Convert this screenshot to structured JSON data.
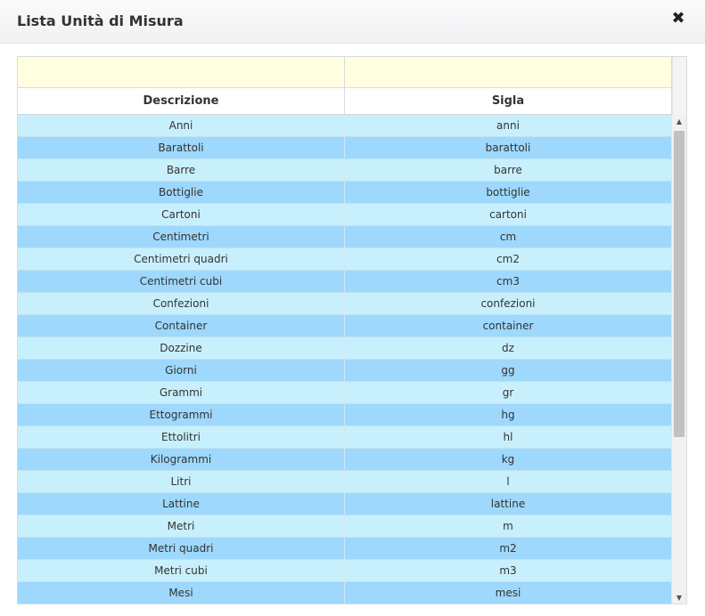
{
  "dialog": {
    "title": "Lista Unità di Misura",
    "close_glyph": "✖"
  },
  "grid": {
    "columns": [
      "Descrizione",
      "Sigla"
    ],
    "filters": [
      "",
      ""
    ],
    "rows": [
      {
        "descrizione": "Anni",
        "sigla": "anni"
      },
      {
        "descrizione": "Barattoli",
        "sigla": "barattoli"
      },
      {
        "descrizione": "Barre",
        "sigla": "barre"
      },
      {
        "descrizione": "Bottiglie",
        "sigla": "bottiglie"
      },
      {
        "descrizione": "Cartoni",
        "sigla": "cartoni"
      },
      {
        "descrizione": "Centimetri",
        "sigla": "cm"
      },
      {
        "descrizione": "Centimetri quadri",
        "sigla": "cm2"
      },
      {
        "descrizione": "Centimetri cubi",
        "sigla": "cm3"
      },
      {
        "descrizione": "Confezioni",
        "sigla": "confezioni"
      },
      {
        "descrizione": "Container",
        "sigla": "container"
      },
      {
        "descrizione": "Dozzine",
        "sigla": "dz"
      },
      {
        "descrizione": "Giorni",
        "sigla": "gg"
      },
      {
        "descrizione": "Grammi",
        "sigla": "gr"
      },
      {
        "descrizione": "Ettogrammi",
        "sigla": "hg"
      },
      {
        "descrizione": "Ettolitri",
        "sigla": "hl"
      },
      {
        "descrizione": "Kilogrammi",
        "sigla": "kg"
      },
      {
        "descrizione": "Litri",
        "sigla": "l"
      },
      {
        "descrizione": "Lattine",
        "sigla": "lattine"
      },
      {
        "descrizione": "Metri",
        "sigla": "m"
      },
      {
        "descrizione": "Metri quadri",
        "sigla": "m2"
      },
      {
        "descrizione": "Metri cubi",
        "sigla": "m3"
      },
      {
        "descrizione": "Mesi",
        "sigla": "mesi"
      }
    ]
  },
  "scrollbar": {
    "up_glyph": "▲",
    "down_glyph": "▼"
  },
  "colors": {
    "row_odd": "#c8f0fc",
    "row_even": "#9ed8fc",
    "filter_bg": "#ffffe0"
  }
}
